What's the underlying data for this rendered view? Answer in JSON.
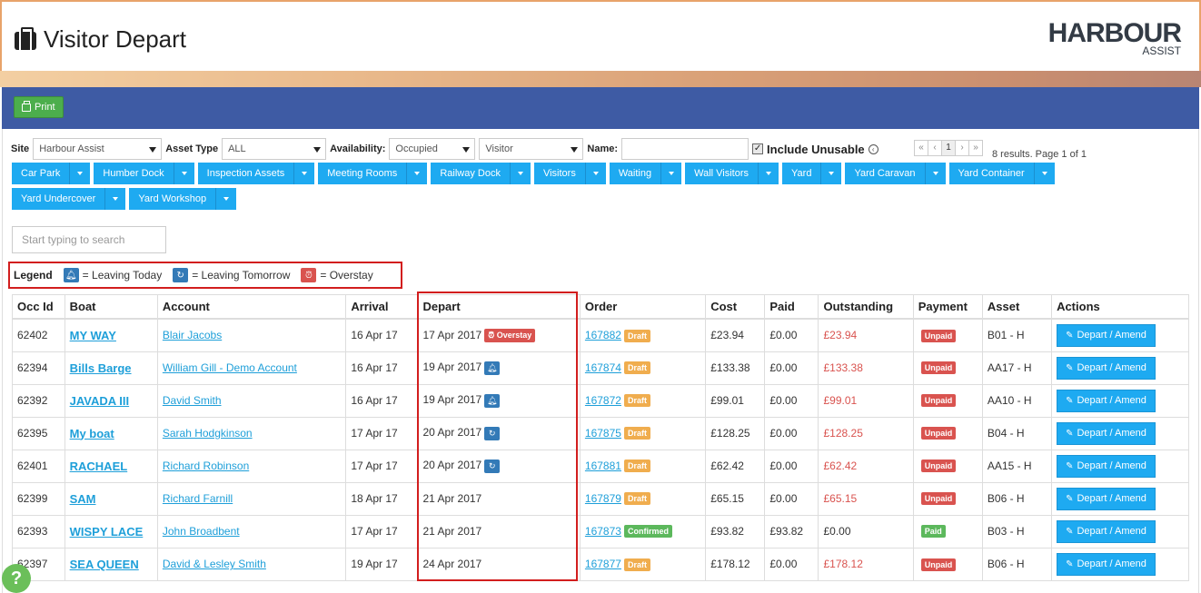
{
  "header": {
    "title": "Visitor Depart",
    "logo_main": "HARBOUR",
    "logo_sub": "ASSIST"
  },
  "toolbar": {
    "print_label": "Print"
  },
  "filters": {
    "site_label": "Site",
    "site_value": "Harbour Assist",
    "asset_type_label": "Asset Type",
    "asset_type_value": "ALL",
    "availability_label": "Availability:",
    "availability_value": "Occupied",
    "visitor_value": "Visitor",
    "name_label": "Name:",
    "include_unusable_label": "Include Unusable",
    "info_glyph": "‹"
  },
  "pager": {
    "first": "«",
    "prev": "‹",
    "page": "1",
    "next": "›",
    "last": "»",
    "results_text": "8 results. Page 1 of 1"
  },
  "categories": [
    {
      "label": "Car Park"
    },
    {
      "label": "Humber Dock"
    },
    {
      "label": "Inspection Assets"
    },
    {
      "label": "Meeting Rooms"
    },
    {
      "label": "Railway Dock"
    },
    {
      "label": "Visitors"
    },
    {
      "label": "Waiting"
    },
    {
      "label": "Wall Visitors"
    },
    {
      "label": "Yard"
    },
    {
      "label": "Yard Caravan"
    },
    {
      "label": "Yard Container"
    },
    {
      "label": "Yard Undercover"
    },
    {
      "label": "Yard Workshop"
    }
  ],
  "search": {
    "placeholder": "Start typing to search"
  },
  "legend": {
    "title": "Legend",
    "leaving_today": "= Leaving Today",
    "leaving_tomorrow": "= Leaving Tomorrow",
    "overstay": "= Overstay"
  },
  "table": {
    "headers": [
      "Occ Id",
      "Boat",
      "Account",
      "Arrival",
      "Depart",
      "Order",
      "Cost",
      "Paid",
      "Outstanding",
      "Payment",
      "Asset",
      "Actions"
    ],
    "action_label": "Depart / Amend",
    "rows": [
      {
        "occ_id": "62402",
        "boat": "MY WAY",
        "account": "Blair Jacobs",
        "arrival": "16 Apr 17",
        "depart": "17 Apr 2017",
        "depart_flag": "overstay",
        "depart_tag": "Overstay",
        "order": "167882",
        "order_status": "Draft",
        "cost": "£23.94",
        "paid": "£0.00",
        "outstanding": "£23.94",
        "outstanding_red": true,
        "payment": "Unpaid",
        "asset": "B01 - H"
      },
      {
        "occ_id": "62394",
        "boat": "Bills Barge",
        "account": "William Gill - Demo Account",
        "arrival": "16 Apr 17",
        "depart": "19 Apr 2017",
        "depart_flag": "today",
        "depart_tag": "",
        "order": "167874",
        "order_status": "Draft",
        "cost": "£133.38",
        "paid": "£0.00",
        "outstanding": "£133.38",
        "outstanding_red": true,
        "payment": "Unpaid",
        "asset": "AA17 - H"
      },
      {
        "occ_id": "62392",
        "boat": "JAVADA III",
        "account": "David Smith",
        "arrival": "16 Apr 17",
        "depart": "19 Apr 2017",
        "depart_flag": "today",
        "depart_tag": "",
        "order": "167872",
        "order_status": "Draft",
        "cost": "£99.01",
        "paid": "£0.00",
        "outstanding": "£99.01",
        "outstanding_red": true,
        "payment": "Unpaid",
        "asset": "AA10 - H"
      },
      {
        "occ_id": "62395",
        "boat": "My boat",
        "account": "Sarah Hodgkinson",
        "arrival": "17 Apr 17",
        "depart": "20 Apr 2017",
        "depart_flag": "tomorrow",
        "depart_tag": "",
        "order": "167875",
        "order_status": "Draft",
        "cost": "£128.25",
        "paid": "£0.00",
        "outstanding": "£128.25",
        "outstanding_red": true,
        "payment": "Unpaid",
        "asset": "B04 - H"
      },
      {
        "occ_id": "62401",
        "boat": "RACHAEL",
        "account": "Richard Robinson",
        "arrival": "17 Apr 17",
        "depart": "20 Apr 2017",
        "depart_flag": "tomorrow",
        "depart_tag": "",
        "order": "167881",
        "order_status": "Draft",
        "cost": "£62.42",
        "paid": "£0.00",
        "outstanding": "£62.42",
        "outstanding_red": true,
        "payment": "Unpaid",
        "asset": "AA15 - H"
      },
      {
        "occ_id": "62399",
        "boat": "SAM",
        "account": "Richard Farnill",
        "arrival": "18 Apr 17",
        "depart": "21 Apr 2017",
        "depart_flag": "",
        "depart_tag": "",
        "order": "167879",
        "order_status": "Draft",
        "cost": "£65.15",
        "paid": "£0.00",
        "outstanding": "£65.15",
        "outstanding_red": true,
        "payment": "Unpaid",
        "asset": "B06 - H"
      },
      {
        "occ_id": "62393",
        "boat": "WISPY LACE",
        "account": "John Broadbent",
        "arrival": "17 Apr 17",
        "depart": "21 Apr 2017",
        "depart_flag": "",
        "depart_tag": "",
        "order": "167873",
        "order_status": "Confirmed",
        "cost": "£93.82",
        "paid": "£93.82",
        "outstanding": "£0.00",
        "outstanding_red": false,
        "payment": "Paid",
        "asset": "B03 - H"
      },
      {
        "occ_id": "62397",
        "boat": "SEA QUEEN",
        "account": "David & Lesley Smith",
        "arrival": "19 Apr 17",
        "depart": "24 Apr 2017",
        "depart_flag": "",
        "depart_tag": "",
        "order": "167877",
        "order_status": "Draft",
        "cost": "£178.12",
        "paid": "£0.00",
        "outstanding": "£178.12",
        "outstanding_red": true,
        "payment": "Unpaid",
        "asset": "B06 - H"
      }
    ]
  },
  "help": {
    "label": "?"
  },
  "colors": {
    "toolbar_blue": "#3e5ba4",
    "button_blue": "#1eaaf1",
    "print_green": "#4cae4c",
    "draft_orange": "#f0ad4e",
    "unpaid_red": "#d9534f",
    "paid_green": "#5cb85c",
    "highlight_red": "#d21e1e"
  }
}
